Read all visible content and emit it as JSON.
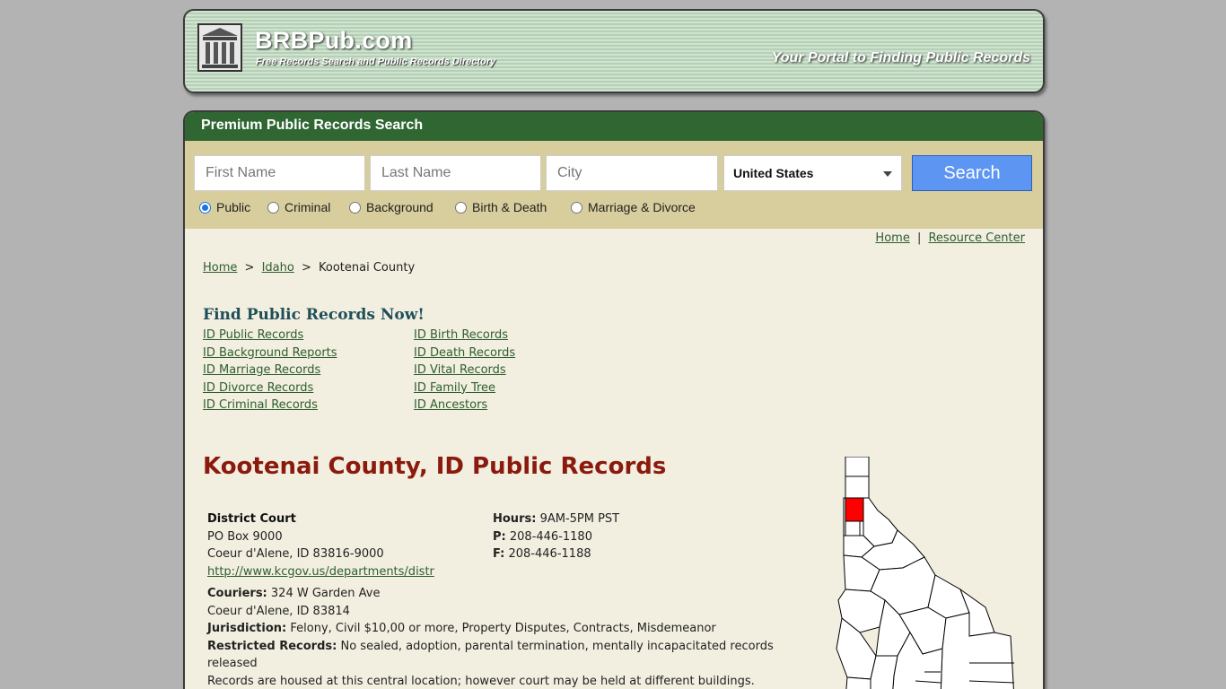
{
  "header": {
    "brand": "BRBPub.com",
    "brand_sub": "Free Records Search and Public Records Directory",
    "tagline": "Your Portal to Finding Public Records"
  },
  "search": {
    "heading": "Premium Public Records Search",
    "first_name_placeholder": "First Name",
    "last_name_placeholder": "Last Name",
    "city_placeholder": "City",
    "country": "United States",
    "button": "Search",
    "types": [
      "Public",
      "Criminal",
      "Background",
      "Birth & Death",
      "Marriage & Divorce"
    ],
    "selected_type": "Public"
  },
  "top_links": {
    "home": "Home",
    "sep": "|",
    "resource": "Resource Center"
  },
  "breadcrumb": {
    "home": "Home",
    "state": "Idaho",
    "current": "Kootenai County",
    "sep": ">"
  },
  "find": {
    "title": "Find Public Records Now!",
    "left": [
      "ID Public Records",
      "ID Background Reports",
      "ID Marriage Records",
      "ID Divorce Records",
      "ID Criminal Records"
    ],
    "right": [
      "ID Birth Records",
      "ID Death Records",
      "ID Vital Records",
      "ID Family Tree",
      "ID Ancestors"
    ]
  },
  "county": {
    "title": "Kootenai County, ID Public Records",
    "court_name": "District Court",
    "address1": "PO Box 9000",
    "address2": "Coeur d'Alene, ID 83816-9000",
    "url": "http://www.kcgov.us/departments/distr",
    "hours_label": "Hours:",
    "hours": "9AM-5PM PST",
    "phone_label": "P:",
    "phone": "208-446-1180",
    "fax_label": "F:",
    "fax": "208-446-1188",
    "couriers_label": "Couriers:",
    "couriers": "324 W Garden Ave",
    "couriers2": "Coeur d'Alene, ID 83814",
    "jurisdiction_label": "Jurisdiction:",
    "jurisdiction": "Felony, Civil $10,00 or more, Property Disputes, Contracts, Misdemeanor",
    "restricted_label": "Restricted Records:",
    "restricted": "No sealed, adoption, parental termination, mentally incapacitated records released",
    "note": "Records are housed at this central location; however court may be held at different buildings."
  },
  "colors": {
    "accent_green": "#2f6632",
    "search_button": "#5c95f2",
    "title_red": "#8b1a0e",
    "highlight_county": "#ff0000"
  }
}
